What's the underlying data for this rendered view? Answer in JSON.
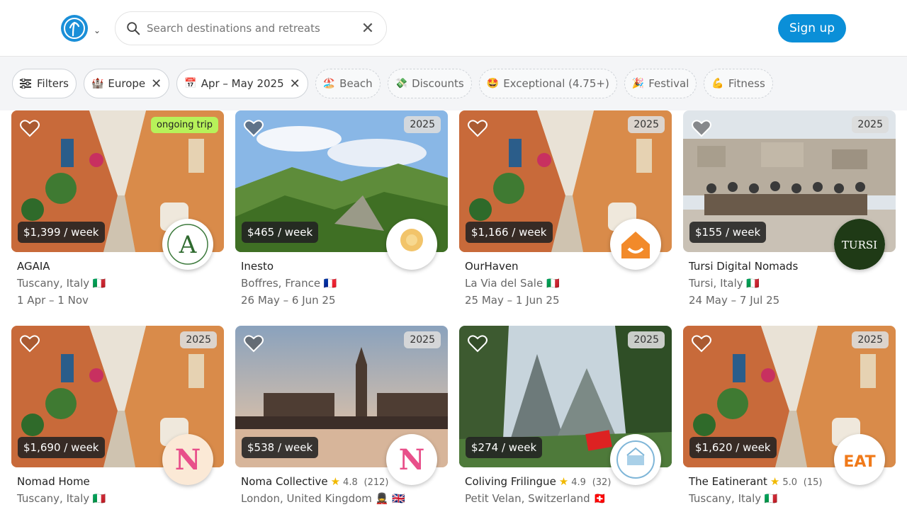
{
  "header": {
    "logo_icon": "palm-tree-logo",
    "search_placeholder": "Search destinations and retreats",
    "signup_label": "Sign up",
    "accent": "#0a8fd8"
  },
  "filters": {
    "filters_label": "Filters",
    "active": [
      {
        "emoji": "🏰",
        "label": "Europe"
      },
      {
        "emoji": "📅",
        "label": "Apr – May 2025"
      }
    ],
    "suggested": [
      {
        "emoji": "🏖️",
        "label": "Beach"
      },
      {
        "emoji": "💸",
        "label": "Discounts"
      },
      {
        "emoji": "🤩",
        "label": "Exceptional (4.75+)"
      },
      {
        "emoji": "🎉",
        "label": "Festival"
      },
      {
        "emoji": "💪",
        "label": "Fitness"
      }
    ]
  },
  "cards": [
    {
      "badge": "ongoing trip",
      "badge_type": "ongoing",
      "price": "$1,399 / week",
      "title": "AGAIA",
      "rating": "",
      "reviews": "",
      "location": "Tuscany, Italy 🇮🇹",
      "dates": "1 Apr – 1 Nov",
      "image": "street",
      "avatar": "A"
    },
    {
      "badge": "2025",
      "badge_type": "year",
      "price": "$465 / week",
      "title": "Inesto",
      "rating": "",
      "reviews": "",
      "location": "Boffres, France 🇫🇷",
      "dates": "26 May – 6 Jun 25",
      "image": "valley",
      "avatar": "inesto"
    },
    {
      "badge": "2025",
      "badge_type": "year",
      "price": "$1,166 / week",
      "title": "OurHaven",
      "rating": "",
      "reviews": "",
      "location": "La Via del Sale 🇮🇹",
      "dates": "25 May – 1 Jun 25",
      "image": "street",
      "avatar": "house"
    },
    {
      "badge": "2025",
      "badge_type": "year",
      "price": "$155 / week",
      "title": "Tursi Digital Nomads",
      "rating": "",
      "reviews": "",
      "location": "Tursi, Italy 🇮🇹",
      "dates": "24 May – 7 Jul 25",
      "image": "group",
      "avatar": "TURSI"
    },
    {
      "badge": "2025",
      "badge_type": "year",
      "price": "$1,690 / week",
      "title": "Nomad Home",
      "rating": "",
      "reviews": "",
      "location": "Tuscany, Italy 🇮🇹",
      "dates": "",
      "image": "street",
      "avatar": "N"
    },
    {
      "badge": "2025",
      "badge_type": "year",
      "price": "$538 / week",
      "title": "Noma Collective",
      "rating": "4.8",
      "reviews": "(212)",
      "location": "London, United Kingdom 💂 🇬🇧",
      "dates": "",
      "image": "london",
      "avatar": "N"
    },
    {
      "badge": "2025",
      "badge_type": "year",
      "price": "$274 / week",
      "title": "Coliving Frilingue",
      "rating": "4.9",
      "reviews": "(32)",
      "location": "Petit Velan, Switzerland 🇨🇭",
      "dates": "",
      "image": "mountain",
      "avatar": "COLIVING"
    },
    {
      "badge": "2025",
      "badge_type": "year",
      "price": "$1,620 / week",
      "title": "The Eatinerant",
      "rating": "5.0",
      "reviews": "(15)",
      "location": "Tuscany, Italy 🇮🇹",
      "dates": "",
      "image": "street",
      "avatar": "EAT"
    }
  ]
}
